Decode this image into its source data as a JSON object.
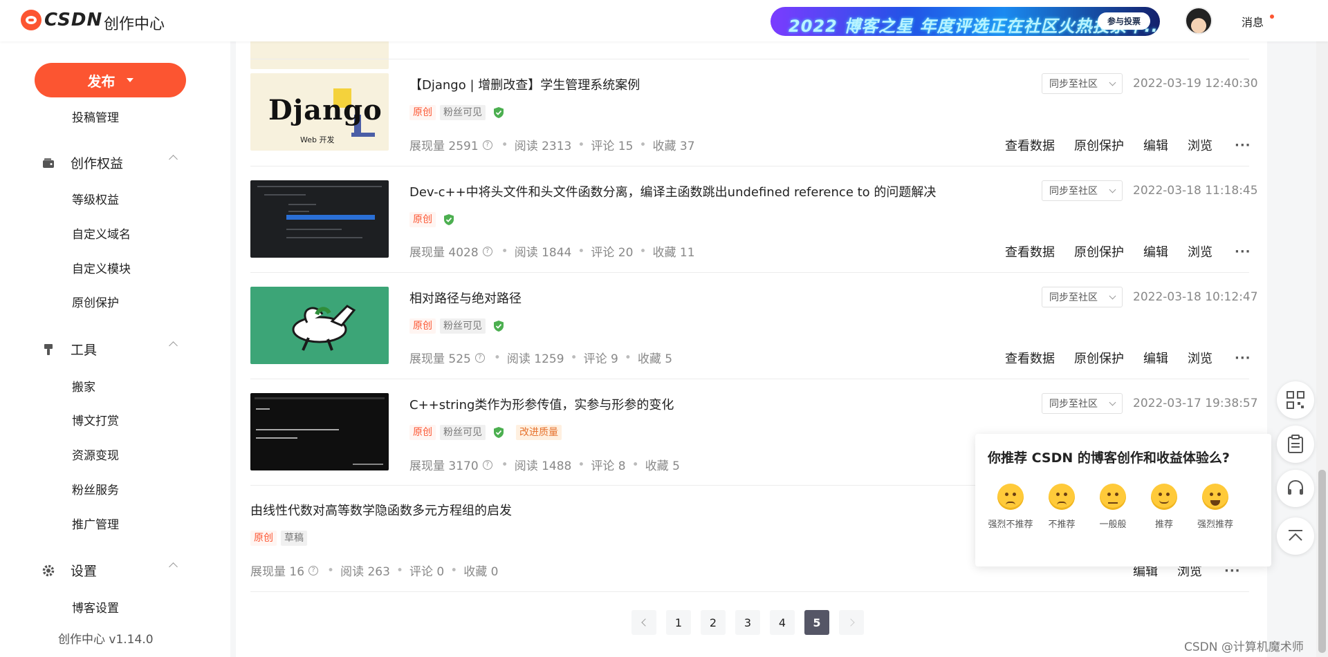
{
  "header": {
    "logo_text": "CSDN",
    "subtitle": "创作中心",
    "banner_text": "2022 博客之星 年度评选正在社区火热投票中......",
    "banner_button": "参与投票",
    "messages_label": "消息"
  },
  "sidebar": {
    "publish_label": "发布",
    "submission_mgmt": "投稿管理",
    "sections": [
      {
        "label": "创作权益",
        "icon": "wallet-icon",
        "items": [
          "等级权益",
          "自定义域名",
          "自定义模块",
          "原创保护"
        ]
      },
      {
        "label": "工具",
        "icon": "brush-icon",
        "items": [
          "搬家",
          "博文打赏",
          "资源变现",
          "粉丝服务",
          "推广管理"
        ]
      },
      {
        "label": "设置",
        "icon": "gear-icon",
        "items": [
          "博客设置"
        ]
      }
    ],
    "version": "创作中心 v1.14.0"
  },
  "articles": [
    {
      "title": "【Django | 增删改查】学生管理系统案例",
      "tags": [
        "原创",
        "粉丝可见"
      ],
      "sync": "同步至社区",
      "date": "2022-03-19 12:40:30",
      "stats": {
        "impressions": "展现量 2591",
        "reads": "阅读 2313",
        "comments": "评论 15",
        "favorites": "收藏 37"
      }
    },
    {
      "title": "Dev-c++中将头文件和头文件函数分离，编译主函数跳出undefined reference to 的问题解决",
      "tags": [
        "原创"
      ],
      "sync": "同步至社区",
      "date": "2022-03-18 11:18:45",
      "stats": {
        "impressions": "展现量 4028",
        "reads": "阅读 1844",
        "comments": "评论 20",
        "favorites": "收藏 11"
      }
    },
    {
      "title": "相对路径与绝对路径",
      "tags": [
        "原创",
        "粉丝可见"
      ],
      "sync": "同步至社区",
      "date": "2022-03-18 10:12:47",
      "stats": {
        "impressions": "展现量 525",
        "reads": "阅读 1259",
        "comments": "评论 9",
        "favorites": "收藏 5"
      }
    },
    {
      "title": "C++string类作为形参传值，实参与形参的变化",
      "tags": [
        "原创",
        "粉丝可见",
        "改进质量"
      ],
      "sync": "同步至社区",
      "date": "2022-03-17 19:38:57",
      "stats": {
        "impressions": "展现量 3170",
        "reads": "阅读 1488",
        "comments": "评论 8",
        "favorites": "收藏 5"
      }
    },
    {
      "title": "由线性代数对高等数学隐函数多元方程组的启发",
      "tags": [
        "原创",
        "草稿"
      ],
      "stats": {
        "impressions": "展现量 16",
        "reads": "阅读 263",
        "comments": "评论 0",
        "favorites": "收藏 0"
      }
    }
  ],
  "actions": {
    "view_data": "查看数据",
    "protect": "原创保护",
    "edit": "编辑",
    "browse": "浏览",
    "more": "···"
  },
  "thumbnails": {
    "django_text": "Django",
    "django_sub": "Web 开发"
  },
  "pagination": {
    "pages": [
      "1",
      "2",
      "3",
      "4",
      "5"
    ],
    "current": "5"
  },
  "survey": {
    "question": "你推荐 CSDN 的博客创作和收益体验么?",
    "options": [
      "强烈不推荐",
      "不推荐",
      "一般般",
      "推荐",
      "强烈推荐"
    ]
  },
  "float_toolbar": [
    "qrcode-icon",
    "clipboard-icon",
    "headset-icon",
    "back-to-top-icon"
  ],
  "watermark": "CSDN @计算机魔术师",
  "colors": {
    "brand": "#fc5531",
    "shield": "#4caf50",
    "active_page": "#555666"
  }
}
